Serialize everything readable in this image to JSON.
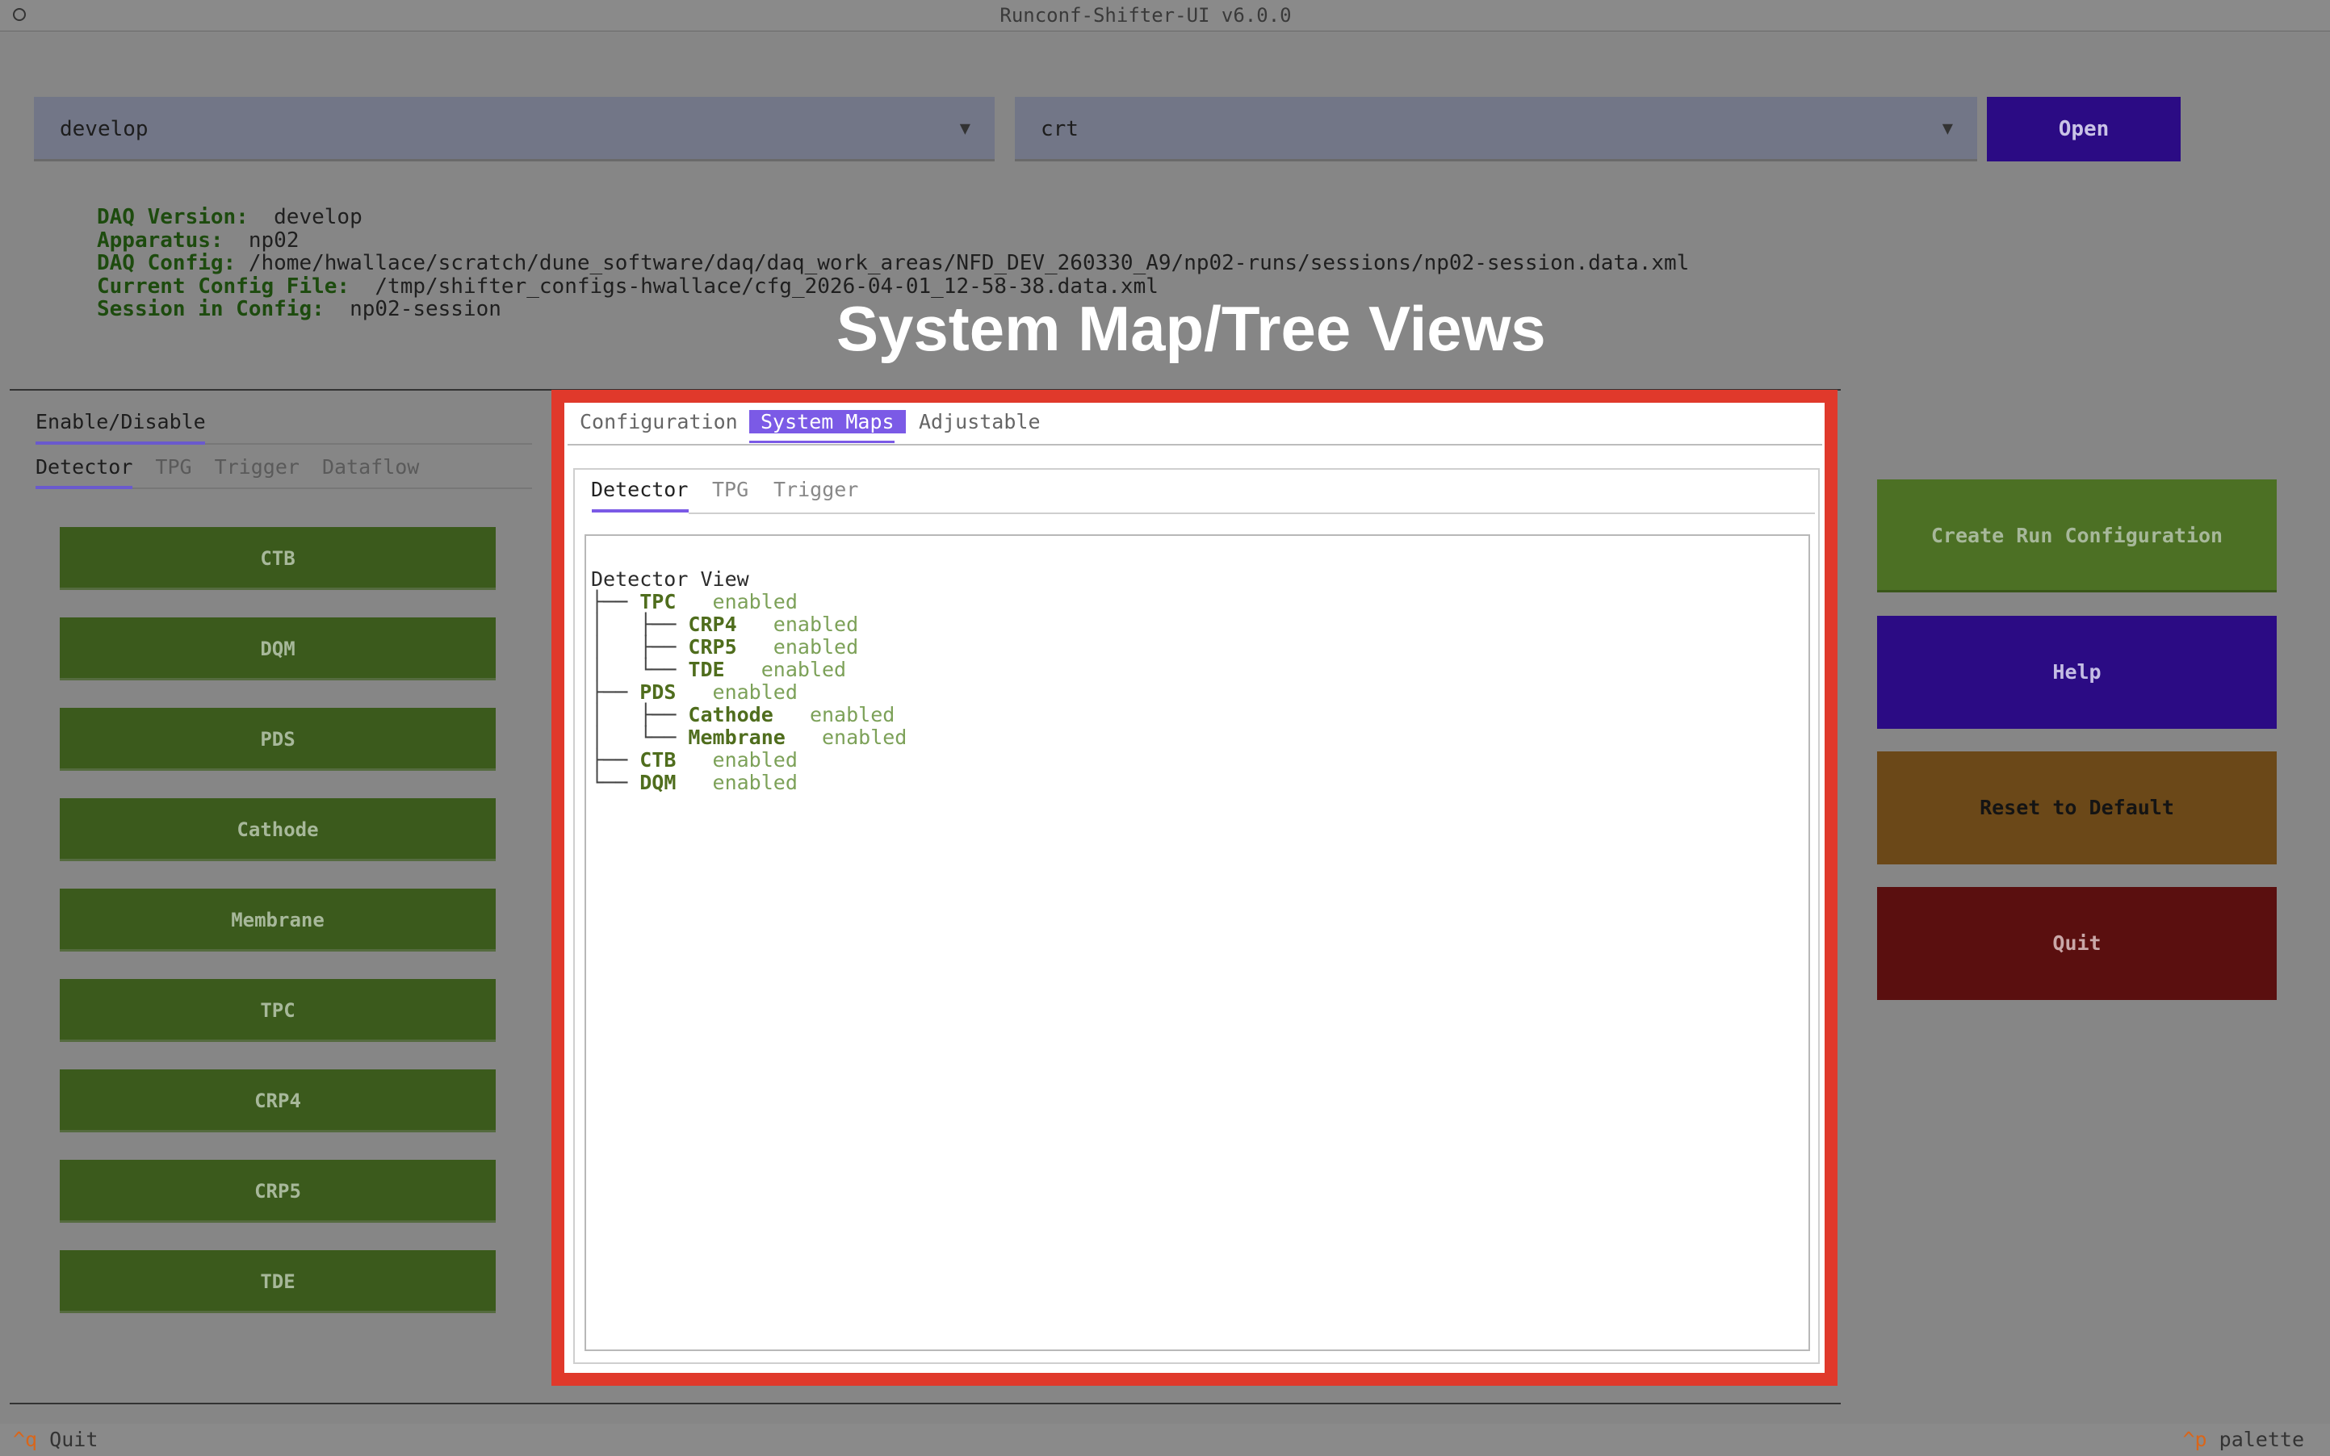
{
  "window": {
    "title": "Runconf-Shifter-UI v6.0.0"
  },
  "selectors": {
    "branch": {
      "value": "develop",
      "caret": "▼"
    },
    "config": {
      "value": "crt",
      "caret": "▼"
    },
    "open_label": "Open"
  },
  "info": {
    "daq_version_label": "DAQ Version:",
    "daq_version": "develop",
    "apparatus_label": "Apparatus:",
    "apparatus": "np02",
    "daq_config_label": "DAQ Config:",
    "daq_config": "/home/hwallace/scratch/dune_software/daq/daq_work_areas/NFD_DEV_260330_A9/np02-runs/sessions/np02-session.data.xml",
    "current_config_label": "Current Config File:",
    "current_config": "/tmp/shifter_configs-hwallace/cfg_2026-04-01_12-58-38.data.xml",
    "session_label": "Session in Config:",
    "session": "np02-session"
  },
  "overlay_heading": "System Map/Tree Views",
  "left_panel": {
    "main_tab": "Enable/Disable",
    "subtabs": [
      "Detector",
      "TPG",
      "Trigger",
      "Dataflow"
    ],
    "buttons": [
      "CTB",
      "DQM",
      "PDS",
      "Cathode",
      "Membrane",
      "TPC",
      "CRP4",
      "CRP5",
      "TDE"
    ]
  },
  "center_panel": {
    "tabs": [
      "Configuration",
      "System Maps",
      "Adjustable"
    ],
    "active_tab": "System Maps",
    "subtabs": [
      "Detector",
      "TPG",
      "Trigger"
    ],
    "active_subtab": "Detector",
    "tree_title": "Detector View",
    "tree": [
      {
        "guide": "├── ",
        "name": "TPC",
        "status": "enabled",
        "children": [
          {
            "guide": "│   ├── ",
            "name": "CRP4",
            "status": "enabled"
          },
          {
            "guide": "│   ├── ",
            "name": "CRP5",
            "status": "enabled"
          },
          {
            "guide": "│   └── ",
            "name": "TDE",
            "status": "enabled"
          }
        ]
      },
      {
        "guide": "├── ",
        "name": "PDS",
        "status": "enabled",
        "children": [
          {
            "guide": "│   ├── ",
            "name": "Cathode",
            "status": "enabled"
          },
          {
            "guide": "│   └── ",
            "name": "Membrane",
            "status": "enabled"
          }
        ]
      },
      {
        "guide": "├── ",
        "name": "CTB",
        "status": "enabled"
      },
      {
        "guide": "└── ",
        "name": "DQM",
        "status": "enabled"
      }
    ]
  },
  "right_panel": {
    "create_label": "Create Run Configuration",
    "help_label": "Help",
    "reset_label": "Reset to Default",
    "quit_label": "Quit"
  },
  "footer": {
    "quit_key": "^q",
    "quit_label": "Quit",
    "palette_key": "^p",
    "palette_label": "palette"
  },
  "colors": {
    "accent": "#7b5ae6",
    "highlight_frame": "#e0392b",
    "enabled_green": "#3b5a1c"
  }
}
